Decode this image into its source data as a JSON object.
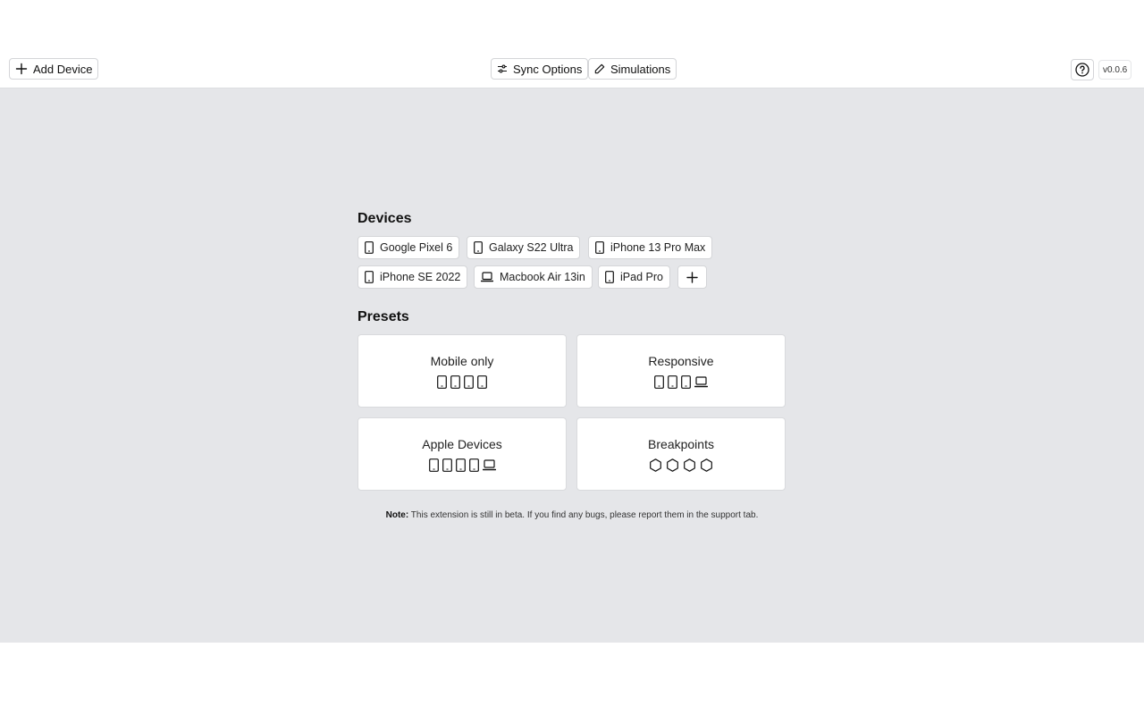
{
  "toolbar": {
    "add_device_label": "Add Device",
    "sync_options_label": "Sync Options",
    "simulations_label": "Simulations",
    "version": "v0.0.6"
  },
  "devices": {
    "title": "Devices",
    "items": [
      {
        "label": "Google Pixel 6",
        "icon": "phone-icon"
      },
      {
        "label": "Galaxy S22 Ultra",
        "icon": "phone-icon"
      },
      {
        "label": "iPhone 13 Pro Max",
        "icon": "phone-icon"
      },
      {
        "label": "iPhone SE 2022",
        "icon": "phone-icon"
      },
      {
        "label": "Macbook Air 13in",
        "icon": "laptop-icon"
      },
      {
        "label": "iPad Pro",
        "icon": "phone-icon"
      }
    ]
  },
  "presets": {
    "title": "Presets",
    "items": [
      {
        "label": "Mobile only",
        "icons": [
          "phone-icon",
          "phone-icon",
          "phone-icon",
          "phone-icon"
        ]
      },
      {
        "label": "Responsive",
        "icons": [
          "phone-icon",
          "phone-icon",
          "phone-icon",
          "laptop-icon"
        ]
      },
      {
        "label": "Apple Devices",
        "icons": [
          "phone-icon",
          "phone-icon",
          "phone-icon",
          "phone-icon",
          "laptop-icon"
        ]
      },
      {
        "label": "Breakpoints",
        "icons": [
          "hexagon-icon",
          "hexagon-icon",
          "hexagon-icon",
          "hexagon-icon"
        ]
      }
    ]
  },
  "note": {
    "label": "Note:",
    "text": " This extension is still in beta. If you find any bugs, please report them in the support tab."
  }
}
